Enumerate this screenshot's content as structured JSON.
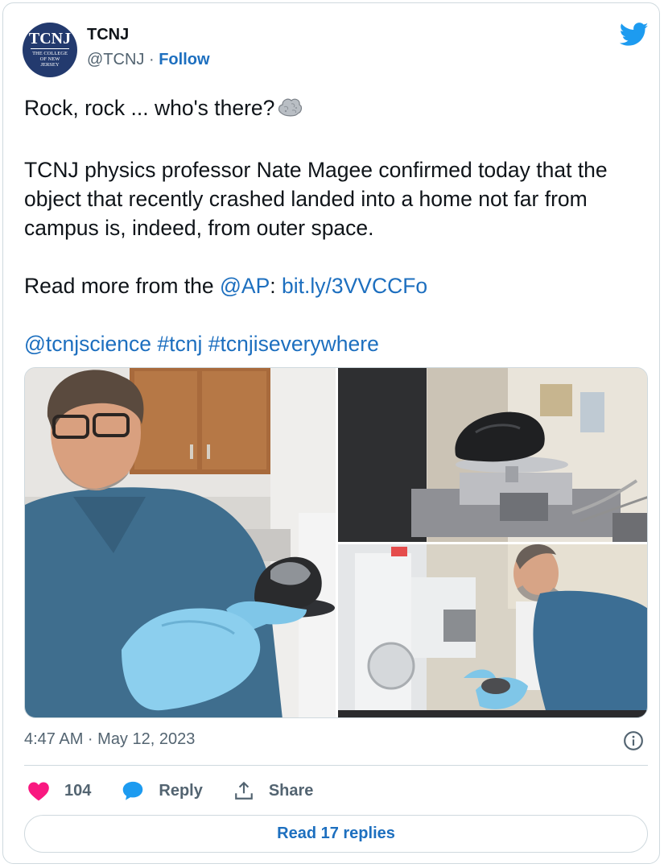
{
  "author": {
    "avatar_big": "TCNJ",
    "avatar_small": "THE COLLEGE OF NEW JERSEY",
    "name": "TCNJ",
    "handle": "@TCNJ",
    "separator": "·",
    "follow_label": "Follow"
  },
  "tweet": {
    "line1": "Rock, rock ... who's there?",
    "paragraph2": "TCNJ physics professor Nate Magee confirmed today that the object that recently crashed landed into a home not far from campus is, indeed, from outer space.",
    "read_more_prefix": "Read more from the ",
    "mention_ap": "@AP",
    "colon": ": ",
    "link": "bit.ly/3VVCCFo",
    "tags": [
      "@tcnjscience",
      "#tcnj",
      "#tcnjiseverywhere"
    ]
  },
  "timestamp": "4:47 AM · May 12, 2023",
  "actions": {
    "like_count": "104",
    "reply_label": "Reply",
    "share_label": "Share"
  },
  "read_replies_label": "Read 17 replies",
  "colors": {
    "link": "#1d6fbf",
    "like": "#f91880",
    "reply": "#1d9bf0",
    "twitter": "#1d9bf0",
    "avatar_bg": "#233a6e"
  },
  "icons": [
    "rock-emoji-icon",
    "twitter-bird-icon",
    "info-icon",
    "heart-icon",
    "reply-bubble-icon",
    "share-icon"
  ]
}
